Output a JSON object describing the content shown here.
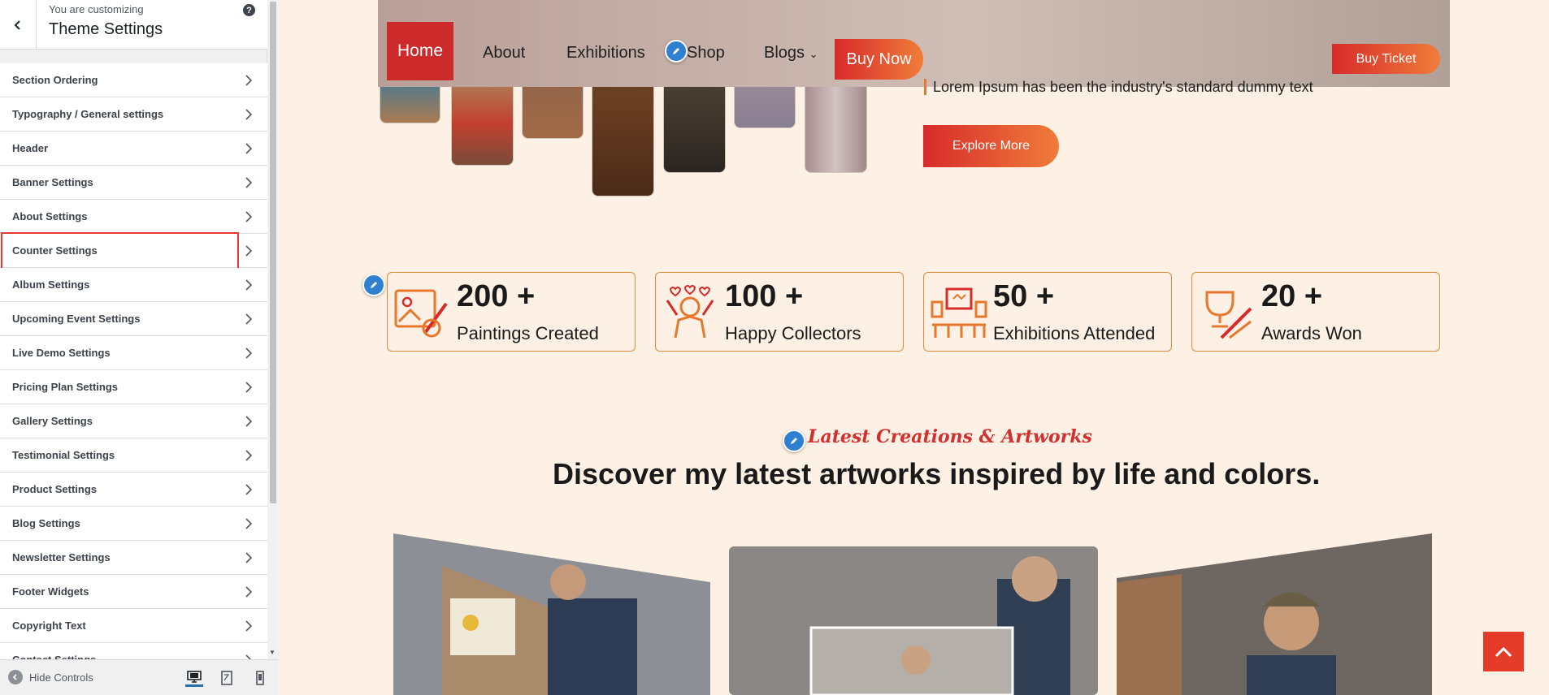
{
  "customizer": {
    "subtitle": "You are customizing",
    "title": "Theme Settings",
    "help": "?",
    "sections": [
      {
        "label": "Section Ordering"
      },
      {
        "label": "Typography / General settings"
      },
      {
        "label": "Header"
      },
      {
        "label": "Banner Settings"
      },
      {
        "label": "About Settings"
      },
      {
        "label": "Counter Settings"
      },
      {
        "label": "Album Settings"
      },
      {
        "label": "Upcoming Event Settings"
      },
      {
        "label": "Live Demo Settings"
      },
      {
        "label": "Pricing Plan Settings"
      },
      {
        "label": "Gallery Settings"
      },
      {
        "label": "Testimonial Settings"
      },
      {
        "label": "Product Settings"
      },
      {
        "label": "Blog Settings"
      },
      {
        "label": "Newsletter Settings"
      },
      {
        "label": "Footer Widgets"
      },
      {
        "label": "Copyright Text"
      },
      {
        "label": "Contact Settings"
      }
    ],
    "hide_controls": "Hide Controls",
    "highlighted_section": "Counter Settings",
    "highlight_color": "#e53935"
  },
  "site": {
    "nav": {
      "home": "Home",
      "about": "About",
      "exhibitions": "Exhibitions",
      "shop": "Shop",
      "blogs": "Blogs",
      "blogs_caret": "⌄",
      "buy_now": "Buy Now",
      "buy_ticket": "Buy Ticket"
    },
    "hero": {
      "lorem": "Lorem Ipsum has been the industry's standard dummy text",
      "explore": "Explore More"
    },
    "counters": [
      {
        "number": "200 +",
        "label": "Paintings Created",
        "icon": "painting-icon"
      },
      {
        "number": "100 +",
        "label": "Happy Collectors",
        "icon": "collectors-icon"
      },
      {
        "number": "50 +",
        "label": "Exhibitions Attended",
        "icon": "exhibition-icon"
      },
      {
        "number": "20 +",
        "label": "Awards Won",
        "icon": "award-icon"
      }
    ],
    "latest": {
      "tag": "Latest Creations & Artworks",
      "heading": "Discover my latest artworks inspired by life and colors."
    },
    "colors": {
      "accent_red": "#d72b2b",
      "accent_orange": "#f07c3a",
      "background": "#fcf1e4",
      "edit_blue": "#2f80d0"
    }
  }
}
